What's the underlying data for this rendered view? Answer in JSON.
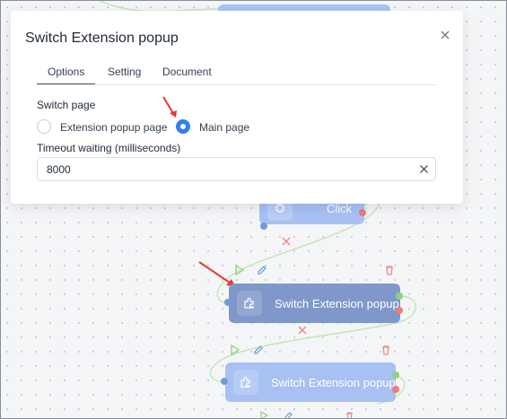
{
  "dialog": {
    "title": "Switch Extension popup",
    "tabs": [
      {
        "label": "Options",
        "active": true
      },
      {
        "label": "Setting",
        "active": false
      },
      {
        "label": "Document",
        "active": false
      }
    ],
    "switch_page_label": "Switch page",
    "radio_options": [
      {
        "label": "Extension popup page",
        "checked": false
      },
      {
        "label": "Main page",
        "checked": true
      }
    ],
    "timeout_label": "Timeout waiting (milliseconds)",
    "timeout_value": "8000"
  },
  "canvas": {
    "nodes": [
      {
        "label": "Click",
        "icon": "click-icon"
      },
      {
        "label": "Switch Extension popup",
        "icon": "puzzle-icon"
      },
      {
        "label": "Switch Extension popup",
        "icon": "puzzle-icon"
      }
    ]
  },
  "colors": {
    "accent": "#2f80ed",
    "node_selected": "#7f98c9",
    "node": "#a8c1f3",
    "port_out_success": "#8fd17f",
    "port_out_error": "#ef7c7c",
    "port_in": "#6d9fd6",
    "annotation_arrow": "#e53935"
  }
}
